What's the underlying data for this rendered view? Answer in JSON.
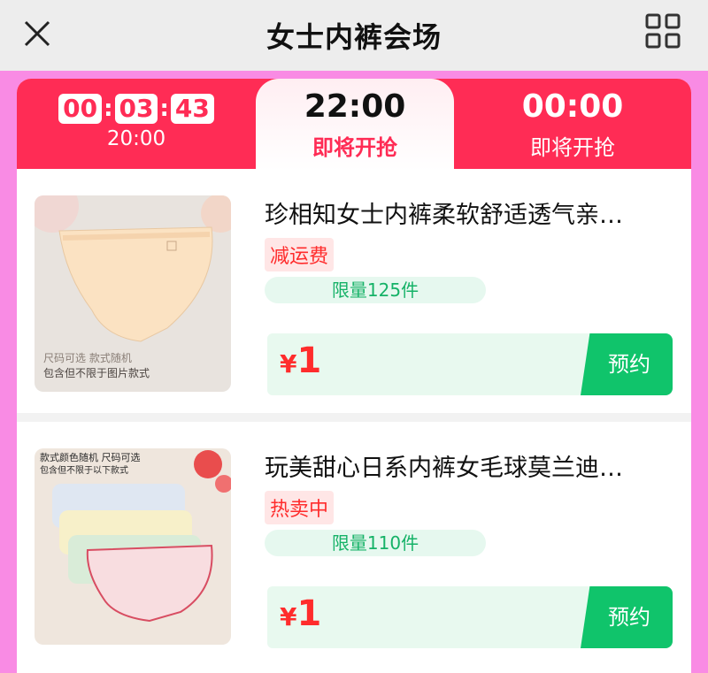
{
  "header": {
    "title": "女士内裤会场",
    "close_icon": "close-icon",
    "grid_icon": "grid-icon"
  },
  "tabs": {
    "current": {
      "timer_h": "00",
      "timer_m": "03",
      "timer_s": "43",
      "time": "20:00"
    },
    "next": {
      "time": "22:00",
      "label": "即将开抢"
    },
    "later": {
      "time": "00:00",
      "label": "即将开抢"
    }
  },
  "products": [
    {
      "title": "珍相知女士内裤柔软舒适透气亲…",
      "tag": "减运费",
      "limit": "限量125件",
      "currency": "¥",
      "price": "1",
      "button": "预约",
      "image_text_1": "尺码可选 款式随机",
      "image_text_2": "包含但不限于图片款式"
    },
    {
      "title": "玩美甜心日系内裤女毛球莫兰迪…",
      "tag": "热卖中",
      "limit": "限量110件",
      "currency": "¥",
      "price": "1",
      "button": "预约",
      "image_text_1": "款式颜色随机 尺码可选",
      "image_text_2": "包含但不限于以下款式"
    }
  ],
  "colors": {
    "accent": "#ff2c55",
    "green": "#10c46b",
    "bg_pink": "#f98be4"
  }
}
